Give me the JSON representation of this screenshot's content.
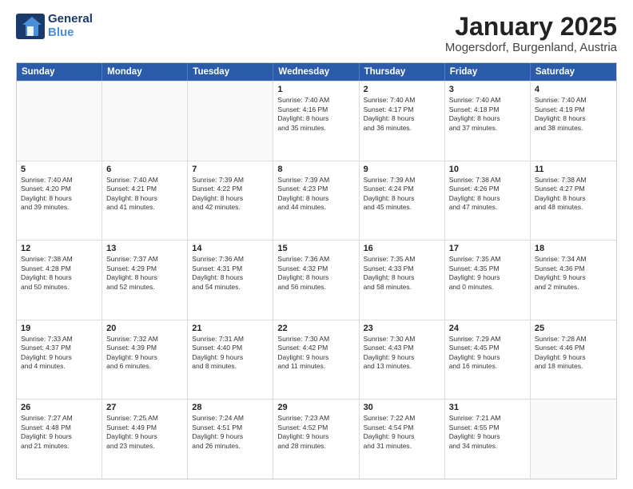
{
  "header": {
    "logo_line1": "General",
    "logo_line2": "Blue",
    "month": "January 2025",
    "location": "Mogersdorf, Burgenland, Austria"
  },
  "weekdays": [
    "Sunday",
    "Monday",
    "Tuesday",
    "Wednesday",
    "Thursday",
    "Friday",
    "Saturday"
  ],
  "rows": [
    [
      {
        "day": "",
        "lines": []
      },
      {
        "day": "",
        "lines": []
      },
      {
        "day": "",
        "lines": []
      },
      {
        "day": "1",
        "lines": [
          "Sunrise: 7:40 AM",
          "Sunset: 4:16 PM",
          "Daylight: 8 hours",
          "and 35 minutes."
        ]
      },
      {
        "day": "2",
        "lines": [
          "Sunrise: 7:40 AM",
          "Sunset: 4:17 PM",
          "Daylight: 8 hours",
          "and 36 minutes."
        ]
      },
      {
        "day": "3",
        "lines": [
          "Sunrise: 7:40 AM",
          "Sunset: 4:18 PM",
          "Daylight: 8 hours",
          "and 37 minutes."
        ]
      },
      {
        "day": "4",
        "lines": [
          "Sunrise: 7:40 AM",
          "Sunset: 4:19 PM",
          "Daylight: 8 hours",
          "and 38 minutes."
        ]
      }
    ],
    [
      {
        "day": "5",
        "lines": [
          "Sunrise: 7:40 AM",
          "Sunset: 4:20 PM",
          "Daylight: 8 hours",
          "and 39 minutes."
        ]
      },
      {
        "day": "6",
        "lines": [
          "Sunrise: 7:40 AM",
          "Sunset: 4:21 PM",
          "Daylight: 8 hours",
          "and 41 minutes."
        ]
      },
      {
        "day": "7",
        "lines": [
          "Sunrise: 7:39 AM",
          "Sunset: 4:22 PM",
          "Daylight: 8 hours",
          "and 42 minutes."
        ]
      },
      {
        "day": "8",
        "lines": [
          "Sunrise: 7:39 AM",
          "Sunset: 4:23 PM",
          "Daylight: 8 hours",
          "and 44 minutes."
        ]
      },
      {
        "day": "9",
        "lines": [
          "Sunrise: 7:39 AM",
          "Sunset: 4:24 PM",
          "Daylight: 8 hours",
          "and 45 minutes."
        ]
      },
      {
        "day": "10",
        "lines": [
          "Sunrise: 7:38 AM",
          "Sunset: 4:26 PM",
          "Daylight: 8 hours",
          "and 47 minutes."
        ]
      },
      {
        "day": "11",
        "lines": [
          "Sunrise: 7:38 AM",
          "Sunset: 4:27 PM",
          "Daylight: 8 hours",
          "and 48 minutes."
        ]
      }
    ],
    [
      {
        "day": "12",
        "lines": [
          "Sunrise: 7:38 AM",
          "Sunset: 4:28 PM",
          "Daylight: 8 hours",
          "and 50 minutes."
        ]
      },
      {
        "day": "13",
        "lines": [
          "Sunrise: 7:37 AM",
          "Sunset: 4:29 PM",
          "Daylight: 8 hours",
          "and 52 minutes."
        ]
      },
      {
        "day": "14",
        "lines": [
          "Sunrise: 7:36 AM",
          "Sunset: 4:31 PM",
          "Daylight: 8 hours",
          "and 54 minutes."
        ]
      },
      {
        "day": "15",
        "lines": [
          "Sunrise: 7:36 AM",
          "Sunset: 4:32 PM",
          "Daylight: 8 hours",
          "and 56 minutes."
        ]
      },
      {
        "day": "16",
        "lines": [
          "Sunrise: 7:35 AM",
          "Sunset: 4:33 PM",
          "Daylight: 8 hours",
          "and 58 minutes."
        ]
      },
      {
        "day": "17",
        "lines": [
          "Sunrise: 7:35 AM",
          "Sunset: 4:35 PM",
          "Daylight: 9 hours",
          "and 0 minutes."
        ]
      },
      {
        "day": "18",
        "lines": [
          "Sunrise: 7:34 AM",
          "Sunset: 4:36 PM",
          "Daylight: 9 hours",
          "and 2 minutes."
        ]
      }
    ],
    [
      {
        "day": "19",
        "lines": [
          "Sunrise: 7:33 AM",
          "Sunset: 4:37 PM",
          "Daylight: 9 hours",
          "and 4 minutes."
        ]
      },
      {
        "day": "20",
        "lines": [
          "Sunrise: 7:32 AM",
          "Sunset: 4:39 PM",
          "Daylight: 9 hours",
          "and 6 minutes."
        ]
      },
      {
        "day": "21",
        "lines": [
          "Sunrise: 7:31 AM",
          "Sunset: 4:40 PM",
          "Daylight: 9 hours",
          "and 8 minutes."
        ]
      },
      {
        "day": "22",
        "lines": [
          "Sunrise: 7:30 AM",
          "Sunset: 4:42 PM",
          "Daylight: 9 hours",
          "and 11 minutes."
        ]
      },
      {
        "day": "23",
        "lines": [
          "Sunrise: 7:30 AM",
          "Sunset: 4:43 PM",
          "Daylight: 9 hours",
          "and 13 minutes."
        ]
      },
      {
        "day": "24",
        "lines": [
          "Sunrise: 7:29 AM",
          "Sunset: 4:45 PM",
          "Daylight: 9 hours",
          "and 16 minutes."
        ]
      },
      {
        "day": "25",
        "lines": [
          "Sunrise: 7:28 AM",
          "Sunset: 4:46 PM",
          "Daylight: 9 hours",
          "and 18 minutes."
        ]
      }
    ],
    [
      {
        "day": "26",
        "lines": [
          "Sunrise: 7:27 AM",
          "Sunset: 4:48 PM",
          "Daylight: 9 hours",
          "and 21 minutes."
        ]
      },
      {
        "day": "27",
        "lines": [
          "Sunrise: 7:25 AM",
          "Sunset: 4:49 PM",
          "Daylight: 9 hours",
          "and 23 minutes."
        ]
      },
      {
        "day": "28",
        "lines": [
          "Sunrise: 7:24 AM",
          "Sunset: 4:51 PM",
          "Daylight: 9 hours",
          "and 26 minutes."
        ]
      },
      {
        "day": "29",
        "lines": [
          "Sunrise: 7:23 AM",
          "Sunset: 4:52 PM",
          "Daylight: 9 hours",
          "and 28 minutes."
        ]
      },
      {
        "day": "30",
        "lines": [
          "Sunrise: 7:22 AM",
          "Sunset: 4:54 PM",
          "Daylight: 9 hours",
          "and 31 minutes."
        ]
      },
      {
        "day": "31",
        "lines": [
          "Sunrise: 7:21 AM",
          "Sunset: 4:55 PM",
          "Daylight: 9 hours",
          "and 34 minutes."
        ]
      },
      {
        "day": "",
        "lines": []
      }
    ]
  ]
}
